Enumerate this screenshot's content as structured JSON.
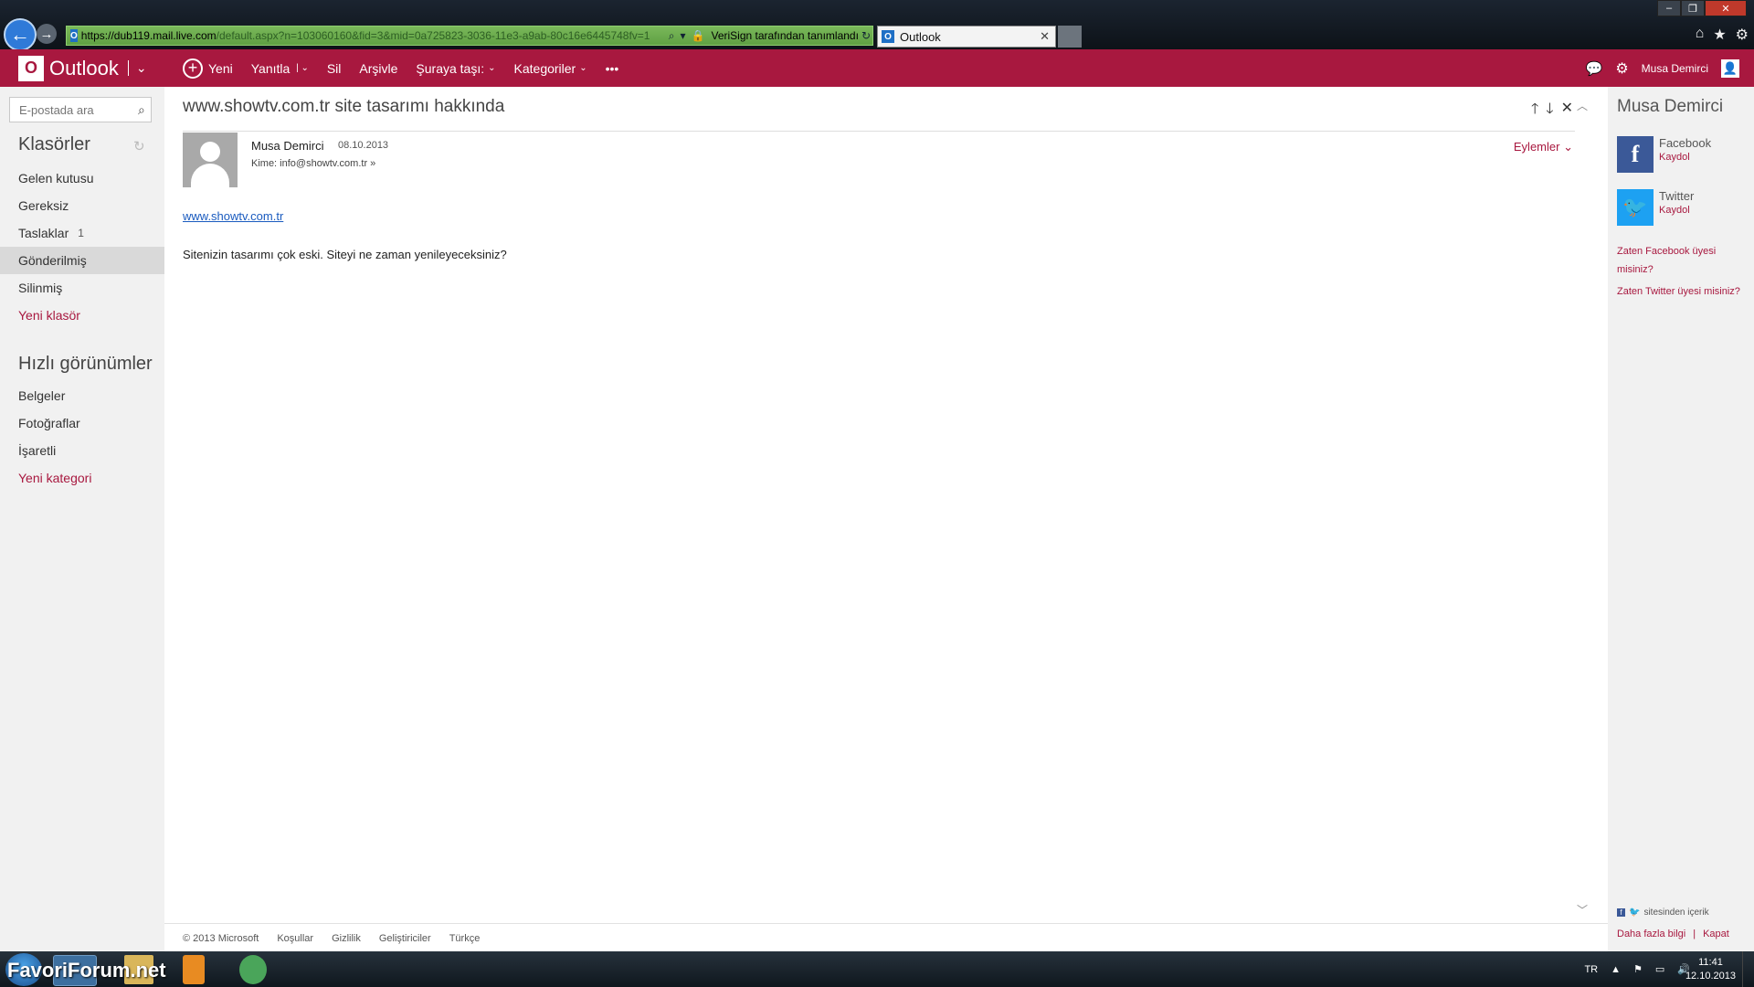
{
  "browser": {
    "url_host": "https://dub119.mail.live.com",
    "url_rest": "/default.aspx?n=103060160&fid=3&mid=0a725823-3036-11e3-a9ab-80c16e6445748fv=1",
    "certificate": "VeriSign tarafından tanımlandı",
    "tab_title": "Outlook"
  },
  "topbar": {
    "app_name": "Outlook",
    "commands": {
      "new": "Yeni",
      "reply": "Yanıtla",
      "delete": "Sil",
      "archive": "Arşivle",
      "move": "Şuraya taşı:",
      "categories": "Kategoriler",
      "more": "•••"
    },
    "user_name": "Musa Demirci"
  },
  "left_nav": {
    "search_placeholder": "E-postada ara",
    "folders_header": "Klasörler",
    "folders": [
      {
        "label": "Gelen kutusu",
        "count": ""
      },
      {
        "label": "Gereksiz",
        "count": ""
      },
      {
        "label": "Taslaklar",
        "count": "1"
      },
      {
        "label": "Gönderilmiş",
        "count": ""
      },
      {
        "label": "Silinmiş",
        "count": ""
      }
    ],
    "new_folder": "Yeni klasör",
    "quickviews_header": "Hızlı görünümler",
    "quickviews": [
      "Belgeler",
      "Fotoğraflar",
      "İşaretli"
    ],
    "new_category": "Yeni kategori"
  },
  "message": {
    "subject": "www.showtv.com.tr site tasarımı hakkında",
    "sender": "Musa Demirci",
    "date": "08.10.2013",
    "recipient": "Kime: info@showtv.com.tr",
    "actions_label": "Eylemler",
    "body_link": "www.showtv.com.tr",
    "body_text": "Sitenizin tasarımı çok eski. Siteyi ne zaman yenileyeceksiniz?"
  },
  "social": {
    "person_name": "Musa Demirci",
    "facebook_title": "Facebook",
    "facebook_action": "Kaydol",
    "twitter_title": "Twitter",
    "twitter_action": "Kaydol",
    "facebook_member": "Zaten Facebook üyesi misiniz?",
    "twitter_member": "Zaten Twitter üyesi misiniz?",
    "content_from": "sitesinden içerik",
    "more_info": "Daha fazla bilgi",
    "close": "Kapat"
  },
  "footer": {
    "copyright": "© 2013 Microsoft",
    "terms": "Koşullar",
    "privacy": "Gizlilik",
    "developers": "Geliştiriciler",
    "language": "Türkçe"
  },
  "taskbar": {
    "watermark": "FavoriForum.net",
    "language": "TR",
    "time": "11:41",
    "date": "12.10.2013"
  },
  "colors": {
    "brand": "#a8183f",
    "link": "#1a5bbf"
  }
}
